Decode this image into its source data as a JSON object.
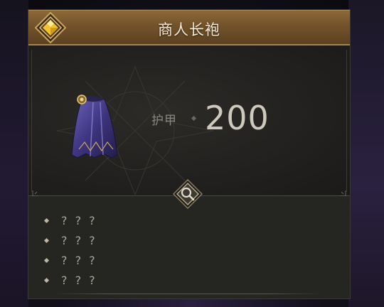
{
  "item": {
    "name": "商人长袍",
    "icon": "cloak-icon",
    "badge_icon": "diamond-gem-icon"
  },
  "stat": {
    "label": "护甲",
    "value": "200"
  },
  "inspect": {
    "icon": "magnifier-icon"
  },
  "affixes": [
    {
      "text": "? ? ?"
    },
    {
      "text": "? ? ?"
    },
    {
      "text": "? ? ?"
    },
    {
      "text": "? ? ?"
    }
  ],
  "colors": {
    "header_gold": "#8e6a3a",
    "gem_yellow": "#f2c230",
    "panel_dark": "#1e1e1c",
    "cloak_purple": "#4a3f8a"
  }
}
